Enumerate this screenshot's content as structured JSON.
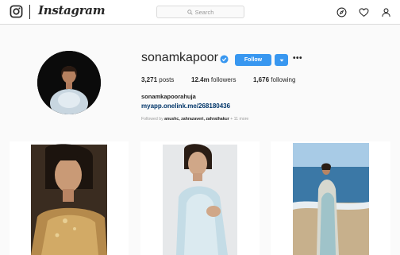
{
  "nav": {
    "brand": "Instagram",
    "search_placeholder": "Search",
    "icons": [
      "instagram-camera-icon",
      "compass-icon",
      "heart-icon",
      "user-icon",
      "search-icon"
    ]
  },
  "profile": {
    "username": "sonamkapoor",
    "verified": true,
    "follow_label": "Follow",
    "dropdown_label": "▾",
    "more_label": "•••",
    "stats": {
      "posts_count": "3,271",
      "posts_label": "posts",
      "followers_count": "12.4m",
      "followers_label": "followers",
      "following_count": "1,676",
      "following_label": "following"
    },
    "full_name": "sonamkapoorahuja",
    "website": "myapp.onelink.me/268180436",
    "followed_by": {
      "prefix": "Followed by",
      "users": "anushc, zahrazaveri, zahrathakur",
      "suffix": "+ 11 more"
    }
  },
  "colors": {
    "accent": "#3897f0",
    "link": "#003569",
    "text": "#262626",
    "muted": "#999999",
    "border": "#dbdbdb",
    "background": "#fafafa"
  }
}
